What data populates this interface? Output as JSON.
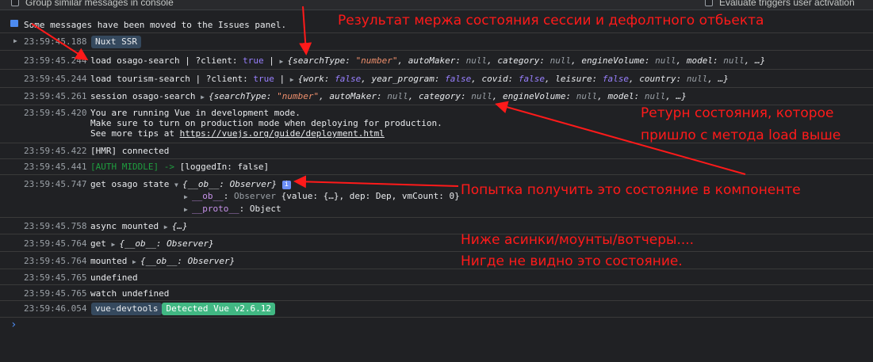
{
  "toolbar": {
    "group_similar": "Group similar messages in console",
    "evaluate_triggers": "Evaluate triggers user activation"
  },
  "issues_notice": "Some messages have been moved to the Issues panel.",
  "rows": {
    "r1": {
      "ts": "23:59:45.188",
      "badge": "Nuxt SSR"
    },
    "r2": {
      "ts": "23:59:45.244",
      "text": "load osago-search",
      "sep1": "  | ?client: ",
      "bool": "true",
      "sep2": "  |  ",
      "obj_open": "{",
      "k1": "searchType: ",
      "v1": "\"number\"",
      "k2": ", autoMaker: ",
      "v2": "null",
      "k3": ", category: ",
      "v3": "null",
      "k4": ", engineVolume: ",
      "v4": "null",
      "k5": ", model: ",
      "v5": "null",
      "obj_close": ", …}"
    },
    "r3": {
      "ts": "23:59:45.244",
      "text": "load tourism-search",
      "sep1": "  | ?client: ",
      "bool": "true",
      "sep2": "  |  ",
      "obj_open": "{",
      "k1": "work: ",
      "v1": "false",
      "k2": ", year_program: ",
      "v2": "false",
      "k3": ", covid: ",
      "v3": "false",
      "k4": ", leisure: ",
      "v4": "false",
      "k5": ", country: ",
      "v5": "null",
      "obj_close": ", …}"
    },
    "r4": {
      "ts": "23:59:45.261",
      "text": "session osago-search ",
      "obj_open": "{",
      "k1": "searchType: ",
      "v1": "\"number\"",
      "k2": ", autoMaker: ",
      "v2": "null",
      "k3": ", category: ",
      "v3": "null",
      "k4": ", engineVolume: ",
      "v4": "null",
      "k5": ", model: ",
      "v5": "null",
      "obj_close": ", …}"
    },
    "r5": {
      "ts": "23:59:45.420",
      "line1": "You are running Vue in development mode.",
      "line2": "Make sure to turn on production mode when deploying for production.",
      "line3_pre": "See more tips at ",
      "line3_link": "https://vuejs.org/guide/deployment.html"
    },
    "r6": {
      "ts": "23:59:45.422",
      "text": "[HMR] connected"
    },
    "r7": {
      "ts": "23:59:45.441",
      "tag": "[AUTH MIDDLE] ->",
      "text": "  [loggedIn: false]"
    },
    "r8": {
      "ts": "23:59:45.747",
      "text": "get osago state ",
      "obj": "{__ob__: Observer}",
      "info": "i",
      "child1_key": "__ob__",
      "child1_pre": ": ",
      "child1_type": "Observer ",
      "child1_val": "{value: {…}, dep: Dep, vmCount: 0}",
      "child2_key": "__proto__",
      "child2_val": ": Object"
    },
    "r9": {
      "ts": "23:59:45.758",
      "text": "async mounted ",
      "obj": "{…}"
    },
    "r10": {
      "ts": "23:59:45.764",
      "text": "get ",
      "obj": "{__ob__: Observer}"
    },
    "r11": {
      "ts": "23:59:45.764",
      "text": "mounted ",
      "obj": "{__ob__: Observer}"
    },
    "r12": {
      "ts": "23:59:45.765",
      "text": "undefined"
    },
    "r13": {
      "ts": "23:59:45.765",
      "text": "watch undefined"
    },
    "r14": {
      "ts": "23:59:46.054",
      "badge1": "vue-devtools",
      "badge2": "Detected Vue v2.6.12"
    }
  },
  "prompt_symbol": "›",
  "annotations": {
    "a1": "Результат мержа состояния сессии и дефолтного отбьекта",
    "a2_l1": "Ретурн состояния, которое",
    "a2_l2": "пришло с метода load выше",
    "a3": "Попытка получить это состояние в компоненте",
    "a4_l1": "Ниже асинки/моунты/вотчеры....",
    "a4_l2": "Нигде не видно это состояние."
  },
  "colors": {
    "annotation": "#ff1a1a",
    "bg": "#202124",
    "vue_green": "#41b883",
    "nuxt_badge": "#35495e"
  }
}
